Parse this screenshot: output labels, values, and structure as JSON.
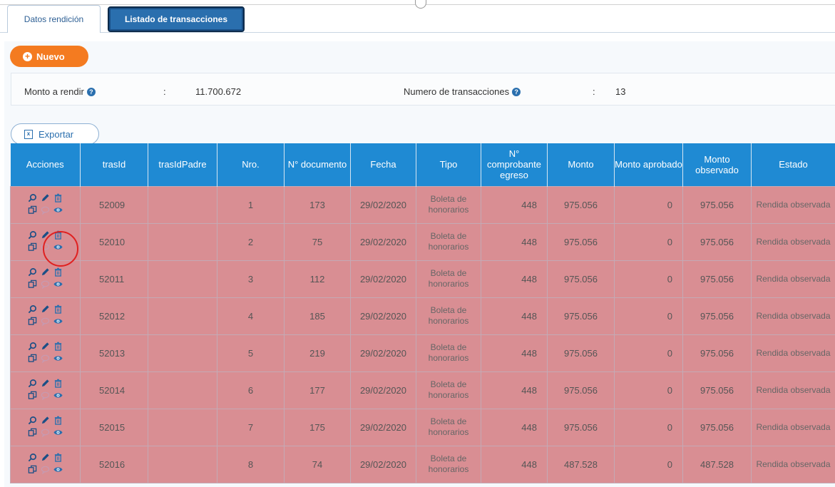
{
  "tabs": [
    {
      "label": "Datos rendición"
    },
    {
      "label": "Listado de transacciones"
    }
  ],
  "toolbar": {
    "nuevo_label": "Nuevo",
    "exportar_label": "Exportar"
  },
  "summary": {
    "monto_label": "Monto a rendir",
    "monto_value": "11.700.672",
    "numero_label": "Numero de transacciones",
    "numero_value": "13",
    "separator": ":"
  },
  "table": {
    "headers": [
      "Acciones",
      "trasId",
      "trasIdPadre",
      "Nro.",
      "N° documento",
      "Fecha",
      "Tipo",
      "N° comprobante egreso",
      "Monto",
      "Monto aprobado",
      "Monto observado",
      "Estado"
    ],
    "rows": [
      {
        "trasId": "52009",
        "trasIdPadre": "",
        "nro": "1",
        "documento": "173",
        "fecha": "29/02/2020",
        "tipo": "Boleta de honorarios",
        "comprobante": "448",
        "monto": "975.056",
        "aprobado": "0",
        "observado": "975.056",
        "estado": "Rendida observada"
      },
      {
        "trasId": "52010",
        "trasIdPadre": "",
        "nro": "2",
        "documento": "75",
        "fecha": "29/02/2020",
        "tipo": "Boleta de honorarios",
        "comprobante": "448",
        "monto": "975.056",
        "aprobado": "0",
        "observado": "975.056",
        "estado": "Rendida observada"
      },
      {
        "trasId": "52011",
        "trasIdPadre": "",
        "nro": "3",
        "documento": "112",
        "fecha": "29/02/2020",
        "tipo": "Boleta de honorarios",
        "comprobante": "448",
        "monto": "975.056",
        "aprobado": "0",
        "observado": "975.056",
        "estado": "Rendida observada"
      },
      {
        "trasId": "52012",
        "trasIdPadre": "",
        "nro": "4",
        "documento": "185",
        "fecha": "29/02/2020",
        "tipo": "Boleta de honorarios",
        "comprobante": "448",
        "monto": "975.056",
        "aprobado": "0",
        "observado": "975.056",
        "estado": "Rendida observada"
      },
      {
        "trasId": "52013",
        "trasIdPadre": "",
        "nro": "5",
        "documento": "219",
        "fecha": "29/02/2020",
        "tipo": "Boleta de honorarios",
        "comprobante": "448",
        "monto": "975.056",
        "aprobado": "0",
        "observado": "975.056",
        "estado": "Rendida observada"
      },
      {
        "trasId": "52014",
        "trasIdPadre": "",
        "nro": "6",
        "documento": "177",
        "fecha": "29/02/2020",
        "tipo": "Boleta de honorarios",
        "comprobante": "448",
        "monto": "975.056",
        "aprobado": "0",
        "observado": "975.056",
        "estado": "Rendida observada"
      },
      {
        "trasId": "52015",
        "trasIdPadre": "",
        "nro": "7",
        "documento": "175",
        "fecha": "29/02/2020",
        "tipo": "Boleta de honorarios",
        "comprobante": "448",
        "monto": "975.056",
        "aprobado": "0",
        "observado": "975.056",
        "estado": "Rendida observada"
      },
      {
        "trasId": "52016",
        "trasIdPadre": "",
        "nro": "8",
        "documento": "74",
        "fecha": "29/02/2020",
        "tipo": "Boleta de honorarios",
        "comprobante": "448",
        "monto": "487.528",
        "aprobado": "0",
        "observado": "487.528",
        "estado": "Rendida observada"
      }
    ]
  },
  "colors": {
    "header": "#1f8ad3",
    "row_observed": "#d98e93",
    "accent": "#f47b20",
    "highlight": "#e02020"
  }
}
